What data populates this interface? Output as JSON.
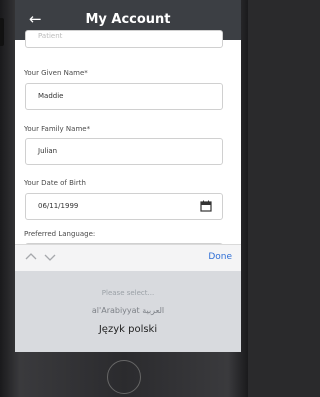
{
  "header": {
    "back_icon": "arrow-left-icon",
    "title": "My Account"
  },
  "form": {
    "cut_label": "Patient",
    "given_name": {
      "label": "Your Given Name*",
      "value": "Maddie"
    },
    "family_name": {
      "label": "Your Family Name*",
      "value": "Julian"
    },
    "dob": {
      "label": "Your Date of Birth",
      "value": "06/11/1999",
      "icon": "calendar-icon"
    },
    "language": {
      "label": "Preferred Language:"
    }
  },
  "toolbar": {
    "prev_icon": "chevron-up-icon",
    "next_icon": "chevron-down-icon",
    "done_label": "Done"
  },
  "picker": {
    "options": [
      "Please select...",
      "al'Arabiyyat العربية",
      "Język polski"
    ]
  },
  "colors": {
    "header_bg": "#3c3f44",
    "done": "#2f6fd6"
  }
}
